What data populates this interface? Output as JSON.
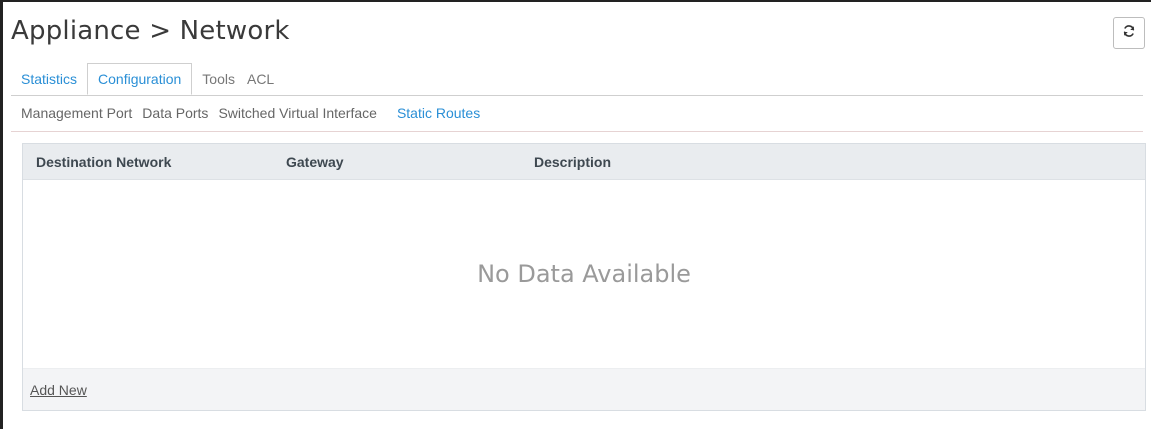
{
  "header": {
    "title": "Appliance > Network",
    "refresh_icon": "refresh-icon"
  },
  "tabs": [
    {
      "label": "Statistics",
      "active": false
    },
    {
      "label": "Configuration",
      "active": true
    },
    {
      "label": "Tools",
      "active": false
    },
    {
      "label": "ACL",
      "active": false
    }
  ],
  "subtabs": [
    {
      "label": "Management Port",
      "active": false
    },
    {
      "label": "Data Ports",
      "active": false
    },
    {
      "label": "Switched Virtual Interface",
      "active": false
    },
    {
      "label": "Static Routes",
      "active": true
    }
  ],
  "table": {
    "columns": [
      "Destination Network",
      "Gateway",
      "Description"
    ],
    "empty_message": "No Data Available",
    "add_new_label": "Add New"
  },
  "colors": {
    "link_blue": "#2a8fd6",
    "header_bg": "#e9ecef",
    "footer_bg": "#f3f4f6"
  }
}
